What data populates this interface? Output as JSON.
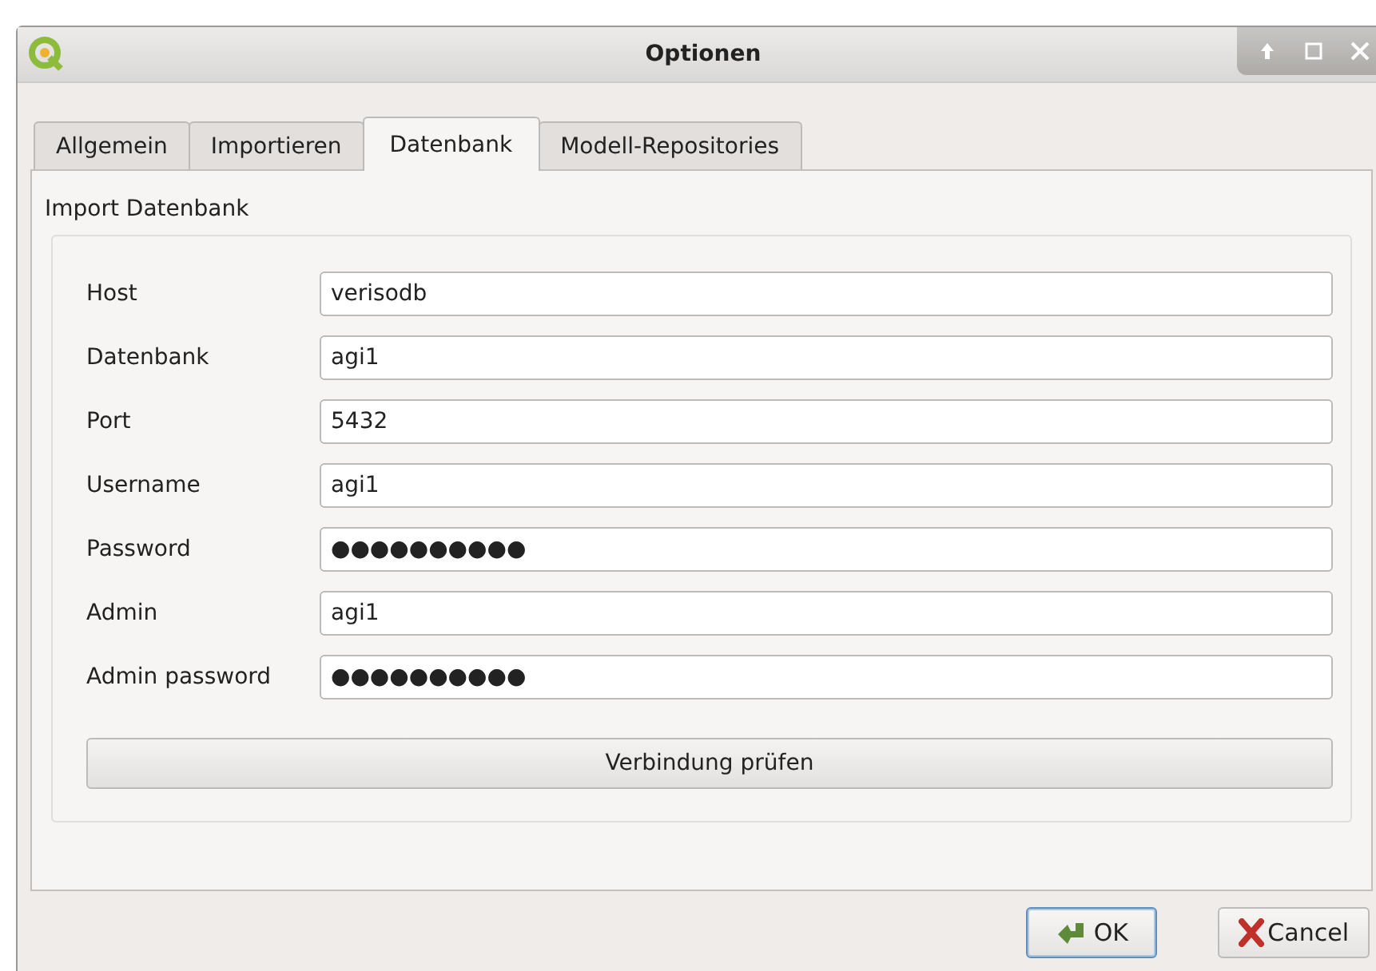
{
  "window": {
    "title": "Optionen"
  },
  "tabs": [
    {
      "label": "Allgemein",
      "selected": false
    },
    {
      "label": "Importieren",
      "selected": false
    },
    {
      "label": "Datenbank",
      "selected": true
    },
    {
      "label": "Modell-Repositories",
      "selected": false
    }
  ],
  "group": {
    "title": "Import Datenbank"
  },
  "fields": [
    {
      "label": "Host",
      "value": "verisodb"
    },
    {
      "label": "Datenbank",
      "value": "agi1"
    },
    {
      "label": "Port",
      "value": "5432"
    },
    {
      "label": "Username",
      "value": "agi1"
    },
    {
      "label": "Password",
      "value": "●●●●●●●●●●"
    },
    {
      "label": "Admin",
      "value": "agi1"
    },
    {
      "label": "Admin password",
      "value": "●●●●●●●●●●"
    }
  ],
  "test_button": "Verbindung prüfen",
  "buttons": [
    {
      "label": "OK",
      "kind": "ok"
    },
    {
      "label": "Cancel",
      "kind": "cancel"
    }
  ]
}
